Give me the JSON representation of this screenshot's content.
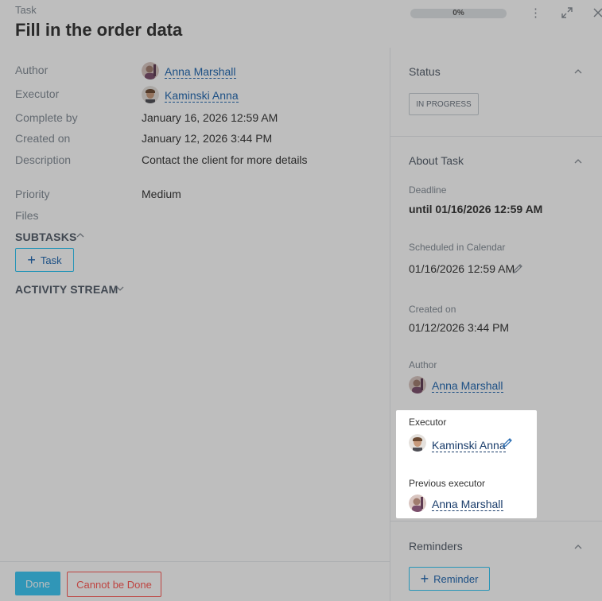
{
  "header": {
    "task_label": "Task",
    "title": "Fill in the order data",
    "progress": "0%",
    "progress_value": 0
  },
  "details": {
    "author_label": "Author",
    "author_name": "Anna Marshall",
    "executor_label": "Executor",
    "executor_name": "Kaminski Anna",
    "complete_by_label": "Complete by",
    "complete_by_value": "January 16, 2026 12:59 AM",
    "created_on_label": "Created on",
    "created_on_value": "January 12, 2026 3:44 PM",
    "description_label": "Description",
    "description_value": "Contact the client for more details",
    "priority_label": "Priority",
    "priority_value": "Medium",
    "files_label": "Files"
  },
  "subtasks": {
    "title": "SUBTASKS",
    "add_label": "Task"
  },
  "activity": {
    "title": "ACTIVITY STREAM"
  },
  "footer": {
    "done_label": "Done",
    "cannot_label": "Cannot be Done"
  },
  "sidebar": {
    "status_title": "Status",
    "status_value": "IN PROGRESS",
    "about_title": "About Task",
    "deadline_label": "Deadline",
    "deadline_value": "until 01/16/2026 12:59 AM",
    "calendar_label": "Scheduled in Calendar",
    "calendar_value": "01/16/2026 12:59 AM",
    "created_label": "Created on",
    "created_value": "01/12/2026 3:44 PM",
    "author_label": "Author",
    "author_name": "Anna Marshall",
    "executor_label": "Executor",
    "executor_name": "Kaminski Anna",
    "prev_executor_label": "Previous executor",
    "prev_executor_name": "Anna Marshall",
    "reminders_title": "Reminders",
    "reminder_add_label": "Reminder"
  },
  "icons": {
    "more": "more-vertical-icon",
    "expand": "expand-icon",
    "close": "close-icon",
    "pencil": "pencil-icon",
    "plus": "plus-icon",
    "chevron_up": "chevron-up-icon",
    "chevron_down": "chevron-down-icon"
  },
  "colors": {
    "accent": "#2fc6f6",
    "done": "#3bc8f5",
    "danger": "#ff5752",
    "link": "#2067b0"
  }
}
